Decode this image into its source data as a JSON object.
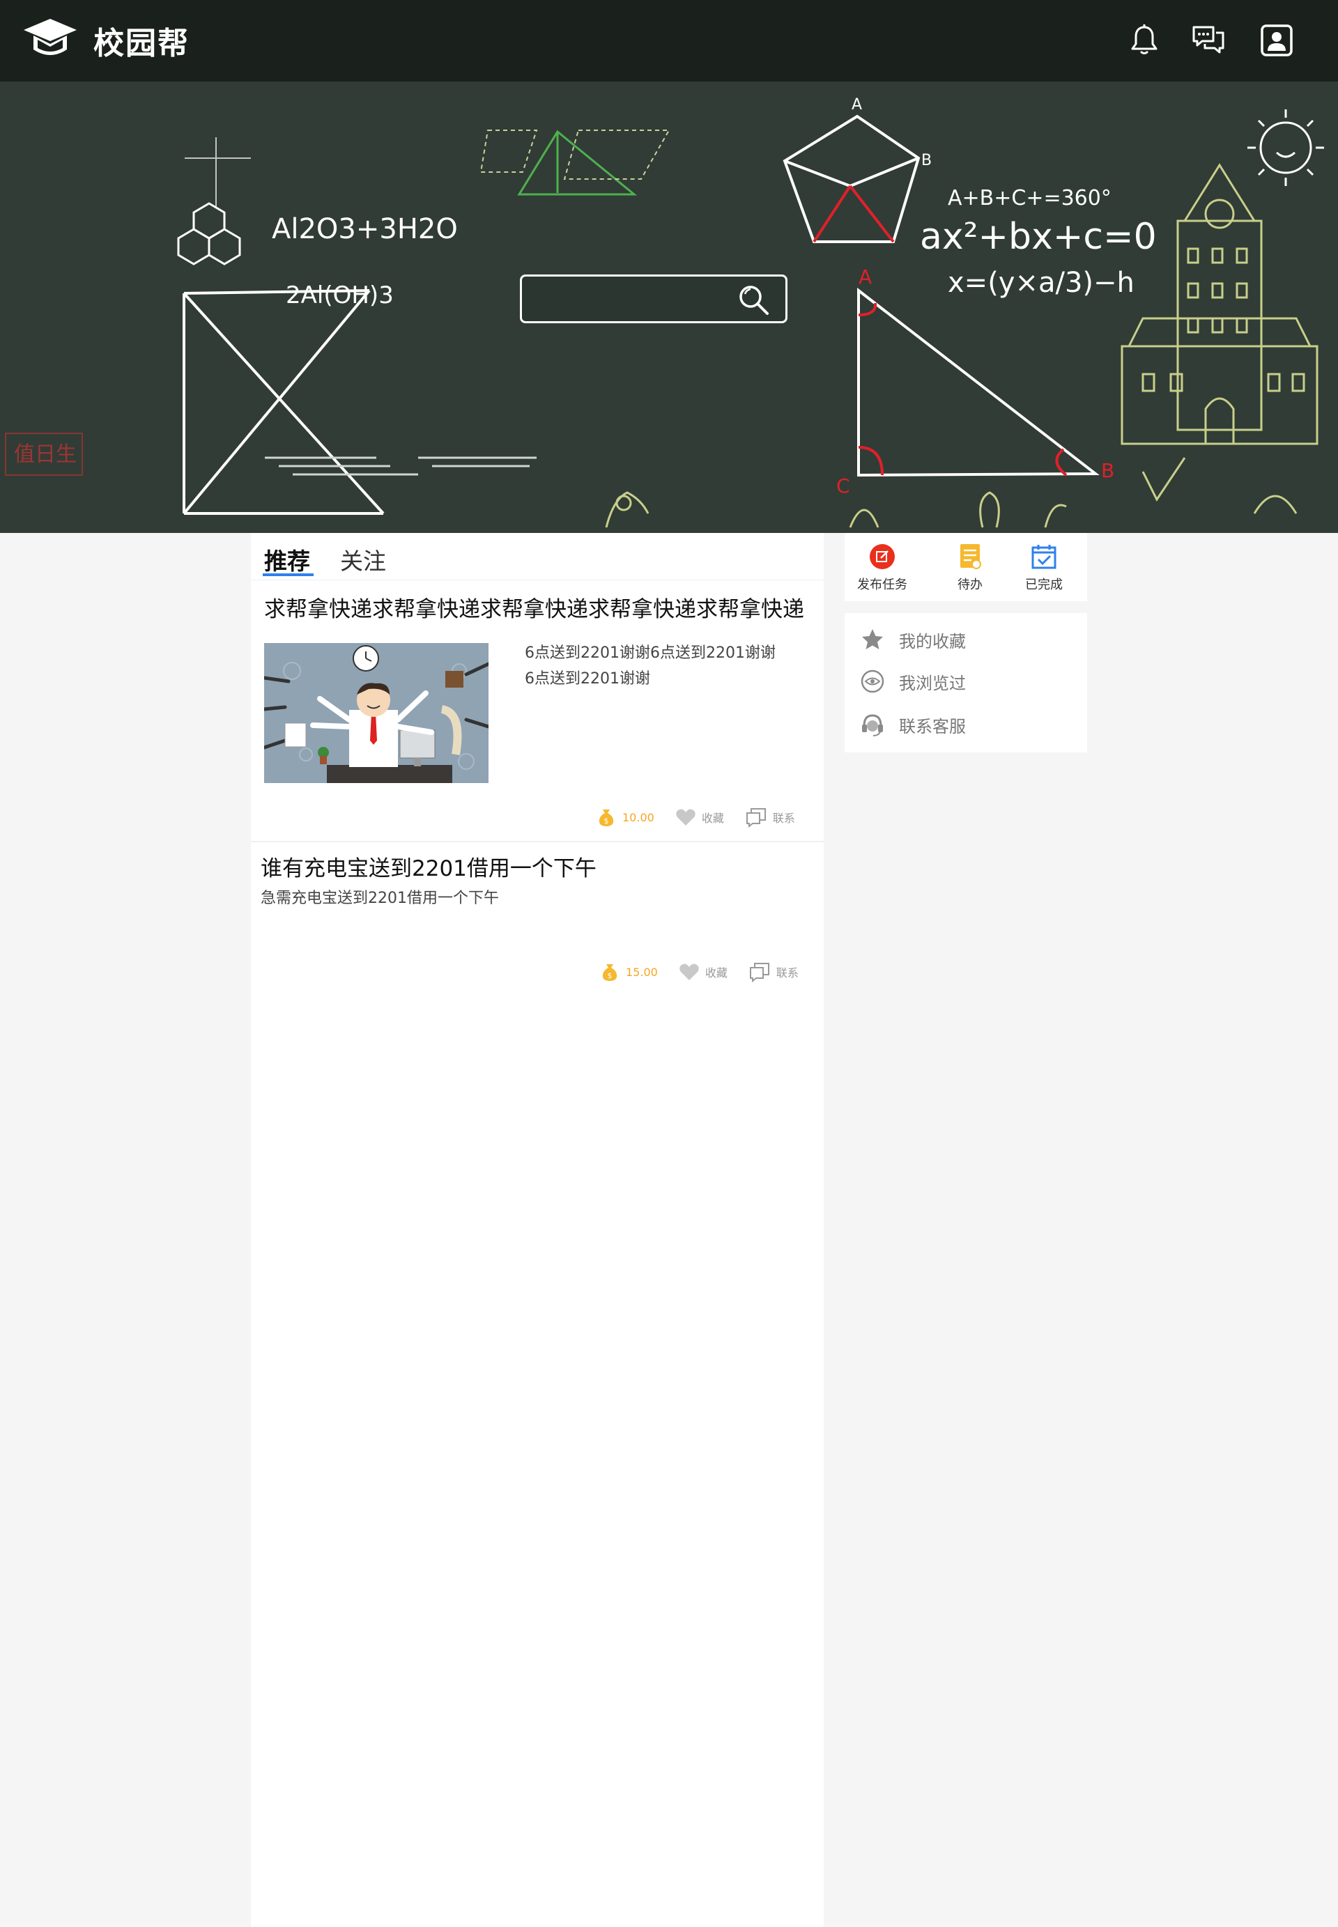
{
  "app": {
    "name": "校园帮",
    "icons": [
      "graduation-cap-icon",
      "bell-icon",
      "chat-icon",
      "user-icon"
    ]
  },
  "search": {
    "placeholder": ""
  },
  "banner": {
    "chalkboard_texts": [
      "Al2O3+3H2O",
      "2Al(OH)3",
      "A+B+C+=360°",
      "ax²+bx+c=0",
      "x=(y×a/3)−h",
      "A",
      "B",
      "C",
      "值日生"
    ]
  },
  "tabs": [
    {
      "label": "推荐",
      "active": true
    },
    {
      "label": "关注",
      "active": false
    }
  ],
  "posts": [
    {
      "title": "求帮拿快递求帮拿快递求帮拿快递求帮拿快递求帮拿快递",
      "description_lines": [
        "6点送到2201谢谢6点送到2201谢谢",
        "6点送到2201谢谢"
      ],
      "reward": "10.00",
      "favorite_label": "收藏",
      "contact_label": "联系",
      "has_image": true
    },
    {
      "title": "谁有充电宝送到2201借用一个下午",
      "description": "急需充电宝送到2201借用一个下午",
      "reward": "15.00",
      "favorite_label": "收藏",
      "contact_label": "联系",
      "has_image": false
    }
  ],
  "quick_actions": [
    {
      "label": "发布任务",
      "icon": "edit-icon",
      "color": "#e8301c"
    },
    {
      "label": "待办",
      "icon": "todo-icon",
      "color": "#f5b82e"
    },
    {
      "label": "已完成",
      "icon": "calendar-check-icon",
      "color": "#2f80ed"
    }
  ],
  "menu": [
    {
      "label": "我的收藏",
      "icon": "star-icon"
    },
    {
      "label": "我浏览过",
      "icon": "eye-icon"
    },
    {
      "label": "联系客服",
      "icon": "headset-icon"
    }
  ],
  "colors": {
    "topbar": "#1a211d",
    "chalkboard": "#2b3531",
    "accent": "#2f80ed",
    "reward": "#f5a623"
  }
}
